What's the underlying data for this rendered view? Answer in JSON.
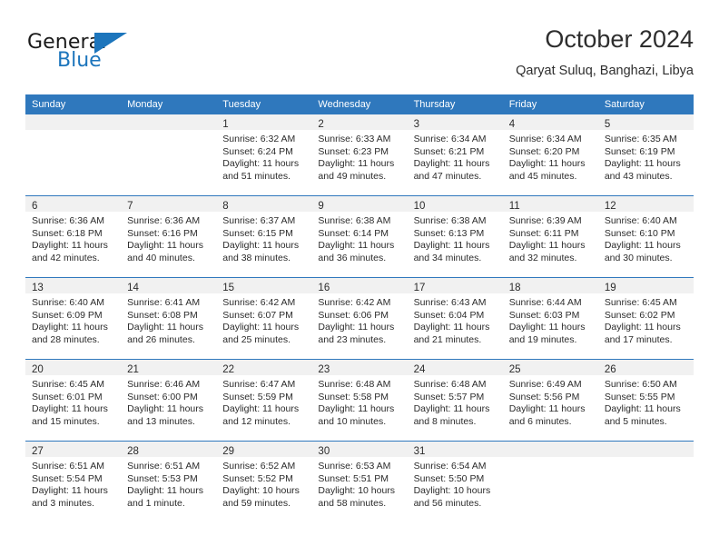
{
  "brand": {
    "name_part1": "General",
    "name_part2": "Blue"
  },
  "header": {
    "title": "October 2024",
    "subtitle": "Qaryat Suluq, Banghazi, Libya"
  },
  "colors": {
    "header_blue": "#2f78bd",
    "logo_blue": "#1c75bc",
    "daynum_band": "#f1f1f1"
  },
  "weekday_headers": [
    "Sunday",
    "Monday",
    "Tuesday",
    "Wednesday",
    "Thursday",
    "Friday",
    "Saturday"
  ],
  "weeks": [
    [
      {
        "day": "",
        "sunrise": "",
        "sunset": "",
        "daylight": ""
      },
      {
        "day": "",
        "sunrise": "",
        "sunset": "",
        "daylight": ""
      },
      {
        "day": "1",
        "sunrise": "Sunrise: 6:32 AM",
        "sunset": "Sunset: 6:24 PM",
        "daylight": "Daylight: 11 hours and 51 minutes."
      },
      {
        "day": "2",
        "sunrise": "Sunrise: 6:33 AM",
        "sunset": "Sunset: 6:23 PM",
        "daylight": "Daylight: 11 hours and 49 minutes."
      },
      {
        "day": "3",
        "sunrise": "Sunrise: 6:34 AM",
        "sunset": "Sunset: 6:21 PM",
        "daylight": "Daylight: 11 hours and 47 minutes."
      },
      {
        "day": "4",
        "sunrise": "Sunrise: 6:34 AM",
        "sunset": "Sunset: 6:20 PM",
        "daylight": "Daylight: 11 hours and 45 minutes."
      },
      {
        "day": "5",
        "sunrise": "Sunrise: 6:35 AM",
        "sunset": "Sunset: 6:19 PM",
        "daylight": "Daylight: 11 hours and 43 minutes."
      }
    ],
    [
      {
        "day": "6",
        "sunrise": "Sunrise: 6:36 AM",
        "sunset": "Sunset: 6:18 PM",
        "daylight": "Daylight: 11 hours and 42 minutes."
      },
      {
        "day": "7",
        "sunrise": "Sunrise: 6:36 AM",
        "sunset": "Sunset: 6:16 PM",
        "daylight": "Daylight: 11 hours and 40 minutes."
      },
      {
        "day": "8",
        "sunrise": "Sunrise: 6:37 AM",
        "sunset": "Sunset: 6:15 PM",
        "daylight": "Daylight: 11 hours and 38 minutes."
      },
      {
        "day": "9",
        "sunrise": "Sunrise: 6:38 AM",
        "sunset": "Sunset: 6:14 PM",
        "daylight": "Daylight: 11 hours and 36 minutes."
      },
      {
        "day": "10",
        "sunrise": "Sunrise: 6:38 AM",
        "sunset": "Sunset: 6:13 PM",
        "daylight": "Daylight: 11 hours and 34 minutes."
      },
      {
        "day": "11",
        "sunrise": "Sunrise: 6:39 AM",
        "sunset": "Sunset: 6:11 PM",
        "daylight": "Daylight: 11 hours and 32 minutes."
      },
      {
        "day": "12",
        "sunrise": "Sunrise: 6:40 AM",
        "sunset": "Sunset: 6:10 PM",
        "daylight": "Daylight: 11 hours and 30 minutes."
      }
    ],
    [
      {
        "day": "13",
        "sunrise": "Sunrise: 6:40 AM",
        "sunset": "Sunset: 6:09 PM",
        "daylight": "Daylight: 11 hours and 28 minutes."
      },
      {
        "day": "14",
        "sunrise": "Sunrise: 6:41 AM",
        "sunset": "Sunset: 6:08 PM",
        "daylight": "Daylight: 11 hours and 26 minutes."
      },
      {
        "day": "15",
        "sunrise": "Sunrise: 6:42 AM",
        "sunset": "Sunset: 6:07 PM",
        "daylight": "Daylight: 11 hours and 25 minutes."
      },
      {
        "day": "16",
        "sunrise": "Sunrise: 6:42 AM",
        "sunset": "Sunset: 6:06 PM",
        "daylight": "Daylight: 11 hours and 23 minutes."
      },
      {
        "day": "17",
        "sunrise": "Sunrise: 6:43 AM",
        "sunset": "Sunset: 6:04 PM",
        "daylight": "Daylight: 11 hours and 21 minutes."
      },
      {
        "day": "18",
        "sunrise": "Sunrise: 6:44 AM",
        "sunset": "Sunset: 6:03 PM",
        "daylight": "Daylight: 11 hours and 19 minutes."
      },
      {
        "day": "19",
        "sunrise": "Sunrise: 6:45 AM",
        "sunset": "Sunset: 6:02 PM",
        "daylight": "Daylight: 11 hours and 17 minutes."
      }
    ],
    [
      {
        "day": "20",
        "sunrise": "Sunrise: 6:45 AM",
        "sunset": "Sunset: 6:01 PM",
        "daylight": "Daylight: 11 hours and 15 minutes."
      },
      {
        "day": "21",
        "sunrise": "Sunrise: 6:46 AM",
        "sunset": "Sunset: 6:00 PM",
        "daylight": "Daylight: 11 hours and 13 minutes."
      },
      {
        "day": "22",
        "sunrise": "Sunrise: 6:47 AM",
        "sunset": "Sunset: 5:59 PM",
        "daylight": "Daylight: 11 hours and 12 minutes."
      },
      {
        "day": "23",
        "sunrise": "Sunrise: 6:48 AM",
        "sunset": "Sunset: 5:58 PM",
        "daylight": "Daylight: 11 hours and 10 minutes."
      },
      {
        "day": "24",
        "sunrise": "Sunrise: 6:48 AM",
        "sunset": "Sunset: 5:57 PM",
        "daylight": "Daylight: 11 hours and 8 minutes."
      },
      {
        "day": "25",
        "sunrise": "Sunrise: 6:49 AM",
        "sunset": "Sunset: 5:56 PM",
        "daylight": "Daylight: 11 hours and 6 minutes."
      },
      {
        "day": "26",
        "sunrise": "Sunrise: 6:50 AM",
        "sunset": "Sunset: 5:55 PM",
        "daylight": "Daylight: 11 hours and 5 minutes."
      }
    ],
    [
      {
        "day": "27",
        "sunrise": "Sunrise: 6:51 AM",
        "sunset": "Sunset: 5:54 PM",
        "daylight": "Daylight: 11 hours and 3 minutes."
      },
      {
        "day": "28",
        "sunrise": "Sunrise: 6:51 AM",
        "sunset": "Sunset: 5:53 PM",
        "daylight": "Daylight: 11 hours and 1 minute."
      },
      {
        "day": "29",
        "sunrise": "Sunrise: 6:52 AM",
        "sunset": "Sunset: 5:52 PM",
        "daylight": "Daylight: 10 hours and 59 minutes."
      },
      {
        "day": "30",
        "sunrise": "Sunrise: 6:53 AM",
        "sunset": "Sunset: 5:51 PM",
        "daylight": "Daylight: 10 hours and 58 minutes."
      },
      {
        "day": "31",
        "sunrise": "Sunrise: 6:54 AM",
        "sunset": "Sunset: 5:50 PM",
        "daylight": "Daylight: 10 hours and 56 minutes."
      },
      {
        "day": "",
        "sunrise": "",
        "sunset": "",
        "daylight": ""
      },
      {
        "day": "",
        "sunrise": "",
        "sunset": "",
        "daylight": ""
      }
    ]
  ]
}
